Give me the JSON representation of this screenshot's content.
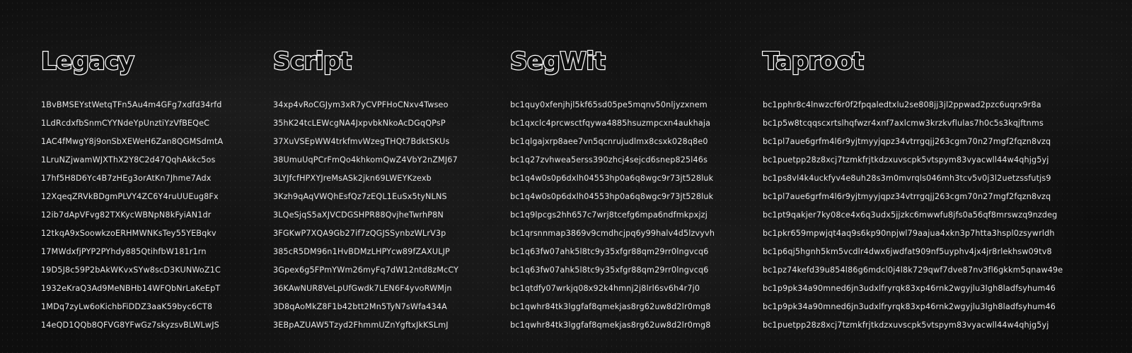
{
  "columns": [
    {
      "id": "legacy",
      "title": "Legacy",
      "addresses": [
        "1BvBMSEYstWetqTFn5Au4m4GFg7xdfd34rfd",
        "1LdRcdxfbSnmCYYNdeYpUnztiYzVfBEQeC",
        "1AC4fMwgY8j9onSbXEWeH6Zan8QGMSdmtA",
        "1LruNZjwamWJXThX2Y8C2d47QqhAkkc5os",
        "17hf5H8D6Yc4B7zHEg3orAtKn7Jhme7Adx",
        "12XqeqZRVkBDgmPLVY4ZC6Y4ruUUEug8Fx",
        "12ib7dApVFvg82TXKycWBNpN8kFyiAN1dr",
        "12tkqA9xSoowkzoERHMWNKsTey55YEBqkv",
        "17MWdxfjPYP2PYhdy885QtihfbW181r1rn",
        "19D5J8c59P2bAkWKvxSYw8scD3KUNWoZ1C",
        "1932eKraQ3Ad9MeNBHb14WFQbNrLaKeEpT",
        "1MDq7zyLw6oKichbFiDDZ3aaK59byc6CT8",
        "14eQD1QQb8QFVG8YFwGz7skyzsvBLWLwJS"
      ]
    },
    {
      "id": "script",
      "title": "Script",
      "addresses": [
        "34xp4vRoCGJym3xR7yCVPFHoCNxv4Twseo",
        "35hK24tcLEWcgNA4JxpvbkNkoAcDGqQPsP",
        "37XuVSEpWW4trkfmvWzegTHQt7BdktSKUs",
        "38UmuUqPCrFmQo4khkomQwZ4VbY2nZMJ67",
        "3LYJfcfHPXYJreMsASk2jkn69LWEYKzexb",
        "3Kzh9qAqVWQhEsfQz7zEQL1EuSx5tyNLNS",
        "3LQeSjqS5aXJVCDGSHPR88QvjheTwrhP8N",
        "3FGKwP7XQA9Gb27if7zQGJSSynbzWLrV3p",
        "385cR5DM96n1HvBDMzLHPYcw89fZAXULJP",
        "3Gpex6g5FPmYWm26myFq7dW12ntd8zMcCY",
        "36KAwNUR8VeLpUfGwdk7LEN6F4yvoRWMjn",
        "3D8qAoMkZ8F1b42btt2Mn5TyN7sWfa434A",
        "3EBpAZUAW5Tzyd2FhmmUZnYgftxJkKSLmJ"
      ]
    },
    {
      "id": "segwit",
      "title": "SegWit",
      "addresses": [
        "bc1quy0xfenjhjl5kf65sd05pe5mqnv50nljyzxnem",
        "bc1qxclc4prcwsctfqywa4885hsuzmpcxn4aukhaja",
        "bc1qlgajxrp8aee7vn5qcnrujudlmx8csxk028q8e0",
        "bc1q27zvhwea5erss390zhcj4sejcd6snep825l46s",
        "bc1q4w0s0p6dxlh04553hp0a6q8wgc9r73jt528luk",
        "bc1q4w0s0p6dxlh04553hp0a6q8wgc9r73jt528luk",
        "bc1q9lpcgs2hh657c7wrj8tcefg6mpa6ndfmkpxjzj",
        "bc1qrsnnmap3869v9cmdhcjpq6y99halv4d5lzvyvh",
        "bc1q63fw07ahk5l8tc9y35xfgr88qm29rr0lngvcq6",
        "bc1q63fw07ahk5l8tc9y35xfgr88qm29rr0lngvcq6",
        "bc1qtdfy07wrkjq08x92k4hmnj2j8lrl6sv6h4r7j0",
        "bc1qwhr84tk3lggfaf8qmekjas8rg62uw8d2lr0mg8",
        "bc1qwhr84tk3lggfaf8qmekjas8rg62uw8d2lr0mg8"
      ]
    },
    {
      "id": "taproot",
      "title": "Taproot",
      "addresses": [
        "bc1pphr8c4lnwzcf6r0f2fpqaledtxlu2se808jj3jl2ppwad2pzc6uqrx9r8a",
        "bc1p5w8tcqqscxrtslhqfwzr4xnf7axlcmw3krzkvflulas7h0c5s3kqjftnms",
        "bc1pl7aue6grfm4l6r9yjtmyyjqpz34vtrrgqjj263cgm70n27mgf2fqzn8vzq",
        "bc1puetpp28z8xcj7tzmkfrjtkdzxuvscpk5vtspym83vyacwll44w4qhjg5yj",
        "bc1ps8vl4k4uckfyv4e8uh28s3m0mvrqls046mh3tcv5v0j3l2uetzssfutjs9",
        "bc1pl7aue6grfm4l6r9yjtmyyjqpz34vtrrgqjj263cgm70n27mgf2fqzn8vzq",
        "bc1pt9qakjer7ky08ce4x6q3udx5jjzkc6mwwfu8jfs0a56qf8mrswzq9nzdeg",
        "bc1pkr659mpwjqt4aq9s6kp90npjwl79aajua4xkn3p7htta3hspl0zsywrldh",
        "bc1p6qj5hgnh5km5vcdlr4dwx6jwdfat909nf5uyphv4jx4jr8rlekhsw09tv8",
        "bc1pz74kefd39u854l86g6mdcl0j4l8k729qwf7dve87nv3fl6gkkm5qnaw49e",
        "bc1p9pk34a90mned6jn3udxlfryrqk83xp46rnk2wgyjlu3lgh8ladfsyhum46",
        "bc1p9pk34a90mned6jn3udxlfryrqk83xp46rnk2wgyjlu3lgh8ladfsyhum46",
        "bc1puetpp28z8xcj7tzmkfrjtkdzxuvscpk5vtspym83vyacwll44w4qhjg5yj"
      ]
    }
  ]
}
